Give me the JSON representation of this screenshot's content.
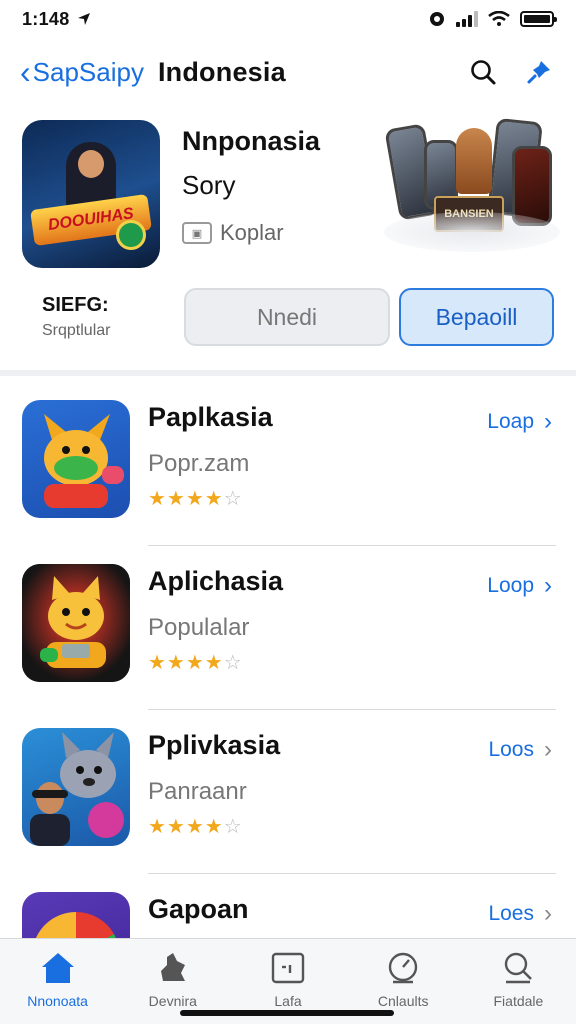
{
  "status_bar": {
    "time": "1:148",
    "battery_level": 1.0
  },
  "nav": {
    "back_label": "SapSaipy",
    "title": "Indonesia",
    "icons": [
      "search-icon",
      "pin-icon"
    ]
  },
  "featured": {
    "title": "Nnponasia",
    "subtitle": "Sory",
    "meta": "Koplar",
    "icon_badge_text": "DOOUIHAS",
    "promo_text": "BANSIEN",
    "left_label": "SIEFG:",
    "left_sublabel": "Srqptlular",
    "button_gray": "Nnedi",
    "button_blue": "Bepaoill"
  },
  "apps": [
    {
      "name": "Paplkasia",
      "category": "Popr.zam",
      "rating": 4,
      "action": "Loap",
      "action_style": "blue"
    },
    {
      "name": "Aplichasia",
      "category": "Populalar",
      "rating": 4,
      "action": "Loop",
      "action_style": "blue"
    },
    {
      "name": "Pplivkasia",
      "category": "Panraanr",
      "rating": 4,
      "action": "Loos",
      "action_style": "gray"
    },
    {
      "name": "Gapoan",
      "category": "",
      "rating": 0,
      "action": "Loes",
      "action_style": "gray"
    }
  ],
  "tab_bar": {
    "tabs": [
      {
        "label": "Nnonoata",
        "icon": "home-icon",
        "active": true
      },
      {
        "label": "Devnira",
        "icon": "games-icon",
        "active": false
      },
      {
        "label": "Lafa",
        "icon": "apps-icon",
        "active": false
      },
      {
        "label": "Cnlaults",
        "icon": "updates-icon",
        "active": false
      },
      {
        "label": "Fiatdale",
        "icon": "profile-icon",
        "active": false
      }
    ]
  },
  "colors": {
    "accent": "#1a6fe0",
    "star": "#f2a81d"
  }
}
